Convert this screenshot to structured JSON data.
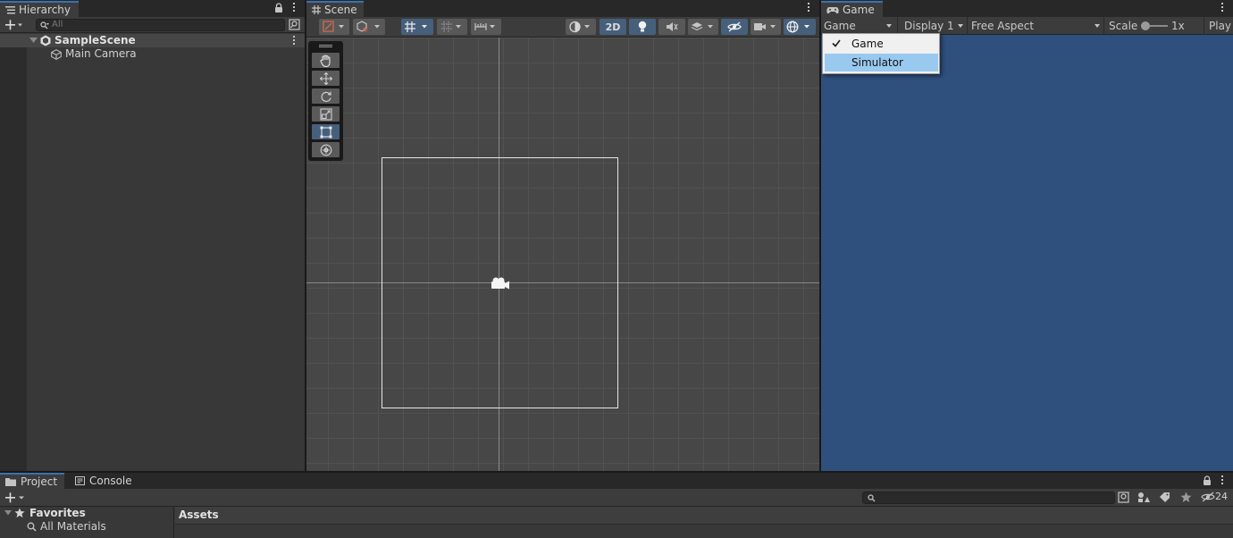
{
  "hierarchy": {
    "tab_label": "Hierarchy",
    "search_placeholder": "All",
    "scene_name": "SampleScene",
    "items": [
      {
        "label": "Main Camera"
      }
    ]
  },
  "scene": {
    "tab_label": "Scene",
    "toggle_2d_label": "2D"
  },
  "game": {
    "tab_label": "Game",
    "view_mode": "Game",
    "display": "Display 1",
    "aspect": "Free Aspect",
    "scale_label": "Scale",
    "scale_value": "1x",
    "play_label": "Play",
    "background_color": "#2f4f7d"
  },
  "view_dropdown": {
    "options": [
      {
        "label": "Game",
        "checked": true
      },
      {
        "label": "Simulator",
        "highlighted": true
      }
    ]
  },
  "project": {
    "tabs": [
      {
        "label": "Project"
      },
      {
        "label": "Console"
      }
    ],
    "hidden_count": "24",
    "favorites_label": "Favorites",
    "favorites_items": [
      {
        "label": "All Materials"
      }
    ],
    "assets_label": "Assets"
  },
  "colors": {
    "accent": "#3a72b0",
    "selection_blue": "#46607c",
    "popup_highlight": "#99c9ef"
  }
}
